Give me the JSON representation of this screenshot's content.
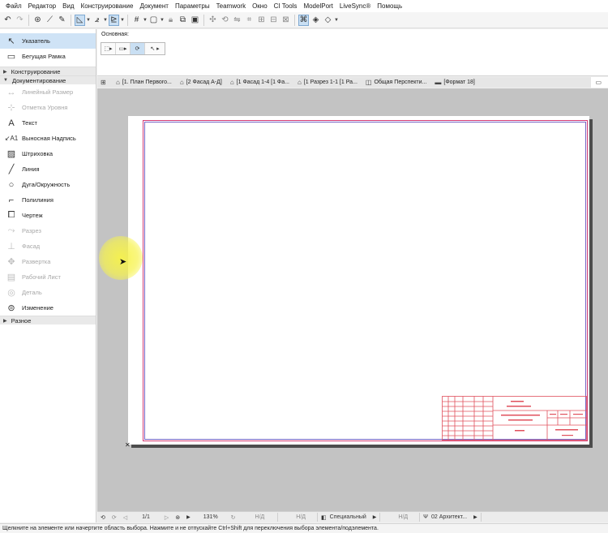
{
  "menu": {
    "items": [
      "Файл",
      "Редактор",
      "Вид",
      "Конструирование",
      "Документ",
      "Параметры",
      "Teamwork",
      "Окно",
      "CI Tools",
      "ModelPort",
      "LiveSync®",
      "Помощь"
    ]
  },
  "toolbar": {
    "buttons": [
      "undo-icon",
      "redo-icon",
      "eyedropper-icon",
      "syringe-icon",
      "pencil-icon",
      "snap-guide-icon",
      "angle-icon",
      "layer-icon",
      "grid-icon",
      "frame-icon",
      "lock-icon",
      "group-icon",
      "suspend-icon",
      "magic-wand-icon",
      "rotate-icon",
      "mirror-icon",
      "offset-icon",
      "align-icon",
      "distribute-icon",
      "trace-icon",
      "3d-view-icon",
      "render-icon"
    ]
  },
  "left_panel": {
    "tools_top": [
      {
        "label": "Указатель",
        "icon": "arrow-pointer-icon",
        "selected": true
      },
      {
        "label": "Бегущая Рамка",
        "icon": "marquee-icon",
        "selected": false
      }
    ],
    "category_construct": "Конструирование",
    "category_document": "Документирование",
    "doc_tools": [
      {
        "label": "Линейный Размер",
        "icon": "dimension-icon",
        "disabled": true
      },
      {
        "label": "Отметка Уровня",
        "icon": "level-mark-icon",
        "disabled": true
      },
      {
        "label": "Текст",
        "icon": "text-icon",
        "disabled": false
      },
      {
        "label": "Выносная Надпись",
        "icon": "label-icon",
        "disabled": false
      },
      {
        "label": "Штриховка",
        "icon": "hatch-icon",
        "disabled": false
      },
      {
        "label": "Линия",
        "icon": "line-icon",
        "disabled": false
      },
      {
        "label": "Дуга/Окружность",
        "icon": "arc-icon",
        "disabled": false
      },
      {
        "label": "Полилиния",
        "icon": "polyline-icon",
        "disabled": false
      },
      {
        "label": "Чертеж",
        "icon": "drawing-icon",
        "disabled": false
      },
      {
        "label": "Разрез",
        "icon": "section-icon",
        "disabled": true
      },
      {
        "label": "Фасад",
        "icon": "elevation-icon",
        "disabled": true
      },
      {
        "label": "Развертка",
        "icon": "interior-elevation-icon",
        "disabled": true
      },
      {
        "label": "Рабочий Лист",
        "icon": "worksheet-icon",
        "disabled": true
      },
      {
        "label": "Деталь",
        "icon": "detail-icon",
        "disabled": true
      },
      {
        "label": "Изменение",
        "icon": "change-icon",
        "disabled": false
      }
    ],
    "category_misc": "Разное"
  },
  "info_box": {
    "label": "Основная:"
  },
  "tabs": [
    {
      "label": "[1. План Первого...",
      "icon": "floor-plan-icon"
    },
    {
      "label": "[2 Фасад А-Д]",
      "icon": "elevation-tab-icon"
    },
    {
      "label": "[1 Фасад 1-4 [1 Фа...",
      "icon": "elevation-tab-icon"
    },
    {
      "label": "[1 Разрез 1-1 [1 Ра...",
      "icon": "section-tab-icon"
    },
    {
      "label": "Общая Перспекти...",
      "icon": "perspective-icon"
    },
    {
      "label": "[Формат 18]",
      "icon": "layout-icon"
    }
  ],
  "nav": {
    "page": "1/1",
    "zoom": "131%",
    "nd1": "Н/Д",
    "nd2": "Н/Д",
    "special": "Специальный",
    "nd3": "Н/Д",
    "arch": "02 Архитект..."
  },
  "status": {
    "text": "Щелкните на элементе или начертите область выбора. Нажмите и не отпускайте Ctrl+Shift для переключения выбора элемента/подэлемента."
  },
  "colors": {
    "frame_outer": "#d33b74",
    "frame_inner": "#7765c6",
    "title_block": "#e0505c",
    "selected": "#cfe3f6",
    "cursor_highlight": "#f7f34a"
  }
}
